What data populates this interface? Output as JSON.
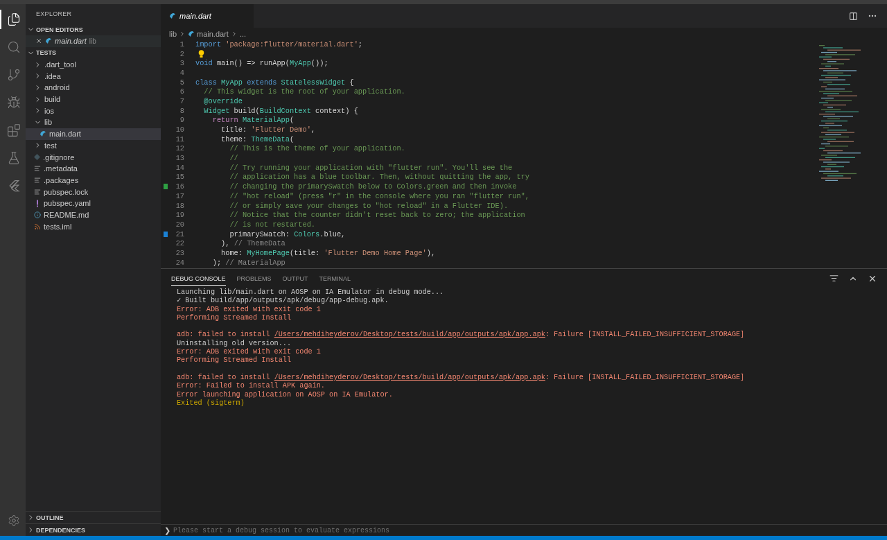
{
  "activity_bar": [
    {
      "kind": "files",
      "selected": true
    },
    {
      "kind": "search",
      "selected": false
    },
    {
      "kind": "git",
      "selected": false
    },
    {
      "kind": "debug",
      "selected": false
    },
    {
      "kind": "extensions",
      "selected": false
    },
    {
      "kind": "testing",
      "selected": false
    },
    {
      "kind": "flutter",
      "selected": false
    }
  ],
  "sidebar": {
    "title": "EXPLORER",
    "open_editors": {
      "label": "OPEN EDITORS",
      "expanded": true,
      "items": [
        {
          "name": "main.dart",
          "folder": "lib",
          "selected": false
        }
      ]
    },
    "workspace": {
      "label": "TESTS",
      "expanded": true,
      "items": [
        {
          "name": ".dart_tool",
          "kind": "folder",
          "expanded": false,
          "selected": false
        },
        {
          "name": ".idea",
          "kind": "folder",
          "expanded": false,
          "selected": false
        },
        {
          "name": "android",
          "kind": "folder",
          "expanded": false,
          "selected": false
        },
        {
          "name": "build",
          "kind": "folder",
          "expanded": false,
          "selected": false
        },
        {
          "name": "ios",
          "kind": "folder",
          "expanded": false,
          "selected": false
        },
        {
          "name": "lib",
          "kind": "folder",
          "expanded": true,
          "selected": false,
          "children": [
            {
              "name": "main.dart",
              "kind": "dart",
              "selected": true
            }
          ]
        },
        {
          "name": "test",
          "kind": "folder",
          "expanded": false,
          "selected": false
        },
        {
          "name": ".gitignore",
          "kind": "git",
          "selected": false
        },
        {
          "name": ".metadata",
          "kind": "text",
          "selected": false
        },
        {
          "name": ".packages",
          "kind": "text",
          "selected": false
        },
        {
          "name": "pubspec.lock",
          "kind": "text",
          "selected": false
        },
        {
          "name": "pubspec.yaml",
          "kind": "yaml",
          "selected": false
        },
        {
          "name": "README.md",
          "kind": "info",
          "selected": false
        },
        {
          "name": "tests.iml",
          "kind": "feed",
          "selected": false
        }
      ]
    },
    "bottom_sections": [
      {
        "label": "OUTLINE",
        "expanded": false
      },
      {
        "label": "DEPENDENCIES",
        "expanded": false
      }
    ]
  },
  "editor": {
    "tabs": [
      {
        "label": "main.dart",
        "selected": true,
        "preview": true
      }
    ],
    "breadcrumb": [
      {
        "label": "lib",
        "kind": "folder"
      },
      {
        "label": "main.dart",
        "kind": "dart"
      },
      {
        "label": "...",
        "kind": "more"
      }
    ],
    "lines": [
      {
        "number": "1",
        "tokens": [
          {
            "kind": "keyword",
            "text": "import"
          },
          {
            "kind": "string",
            "text": " 'package:flutter/material.dart'"
          },
          {
            "kind": "plain",
            "text": ";"
          }
        ]
      },
      {
        "number": "2",
        "lightbulb": true
      },
      {
        "number": "3",
        "tokens": [
          {
            "kind": "keyword",
            "text": "void"
          },
          {
            "kind": "plain",
            "text": " main() => runApp("
          },
          {
            "kind": "type",
            "text": "MyApp"
          },
          {
            "kind": "plain",
            "text": "());"
          }
        ]
      },
      {
        "number": "4"
      },
      {
        "number": "5",
        "tokens": [
          {
            "kind": "keyword",
            "text": "class"
          },
          {
            "kind": "type",
            "text": " MyApp"
          },
          {
            "kind": "keyword",
            "text": " extends"
          },
          {
            "kind": "type",
            "text": " StatelessWidget"
          },
          {
            "kind": "plain",
            "text": " {"
          }
        ]
      },
      {
        "number": "6",
        "tokens": [
          {
            "kind": "comment",
            "text": "  // This widget is the root of your application."
          }
        ]
      },
      {
        "number": "7",
        "tokens": [
          {
            "kind": "annotation",
            "text": "  @override"
          }
        ]
      },
      {
        "number": "8",
        "tokens": [
          {
            "kind": "type",
            "text": "  Widget"
          },
          {
            "kind": "plain",
            "text": " build("
          },
          {
            "kind": "type",
            "text": "BuildContext"
          },
          {
            "kind": "plain",
            "text": " context) {"
          }
        ]
      },
      {
        "number": "9",
        "tokens": [
          {
            "kind": "control",
            "text": "    return"
          },
          {
            "kind": "type",
            "text": " MaterialApp"
          },
          {
            "kind": "plain",
            "text": "("
          }
        ]
      },
      {
        "number": "10",
        "tokens": [
          {
            "kind": "plain",
            "text": "      title: "
          },
          {
            "kind": "string",
            "text": "'Flutter Demo'"
          },
          {
            "kind": "plain",
            "text": ","
          }
        ]
      },
      {
        "number": "11",
        "tokens": [
          {
            "kind": "plain",
            "text": "      theme: "
          },
          {
            "kind": "type",
            "text": "ThemeData"
          },
          {
            "kind": "plain",
            "text": "("
          }
        ]
      },
      {
        "number": "12",
        "tokens": [
          {
            "kind": "comment",
            "text": "        // This is the theme of your application."
          }
        ]
      },
      {
        "number": "13",
        "tokens": [
          {
            "kind": "comment",
            "text": "        //"
          }
        ]
      },
      {
        "number": "14",
        "tokens": [
          {
            "kind": "comment",
            "text": "        // Try running your application with \"flutter run\". You'll see the"
          }
        ]
      },
      {
        "number": "15",
        "tokens": [
          {
            "kind": "comment",
            "text": "        // application has a blue toolbar. Then, without quitting the app, try"
          }
        ]
      },
      {
        "number": "16",
        "gutter_marker": {
          "color": "#2ea043"
        },
        "tokens": [
          {
            "kind": "comment",
            "text": "        // changing the primarySwatch below to Colors.green and then invoke"
          }
        ]
      },
      {
        "number": "17",
        "tokens": [
          {
            "kind": "comment",
            "text": "        // \"hot reload\" (press \"r\" in the console where you ran \"flutter run\","
          }
        ]
      },
      {
        "number": "18",
        "tokens": [
          {
            "kind": "comment",
            "text": "        // or simply save your changes to \"hot reload\" in a Flutter IDE)."
          }
        ]
      },
      {
        "number": "19",
        "tokens": [
          {
            "kind": "comment",
            "text": "        // Notice that the counter didn't reset back to zero; the application"
          }
        ]
      },
      {
        "number": "20",
        "tokens": [
          {
            "kind": "comment",
            "text": "        // is not restarted."
          }
        ]
      },
      {
        "number": "21",
        "gutter_marker": {
          "color": "#1b81d4"
        },
        "tokens": [
          {
            "kind": "plain",
            "text": "        primarySwatch: "
          },
          {
            "kind": "type",
            "text": "Colors"
          },
          {
            "kind": "plain",
            "text": ".blue,"
          }
        ]
      },
      {
        "number": "22",
        "tokens": [
          {
            "kind": "plain",
            "text": "      ), "
          },
          {
            "kind": "hint",
            "text": "// ThemeData"
          }
        ]
      },
      {
        "number": "23",
        "tokens": [
          {
            "kind": "plain",
            "text": "      home: "
          },
          {
            "kind": "type",
            "text": "MyHomePage"
          },
          {
            "kind": "plain",
            "text": "(title: "
          },
          {
            "kind": "string",
            "text": "'Flutter Demo Home Page'"
          },
          {
            "kind": "plain",
            "text": "),"
          }
        ]
      },
      {
        "number": "24",
        "tokens": [
          {
            "kind": "plain",
            "text": "    ); "
          },
          {
            "kind": "hint",
            "text": "// MaterialApp"
          }
        ]
      }
    ]
  },
  "panel": {
    "tabs": [
      {
        "label": "DEBUG CONSOLE",
        "selected": true
      },
      {
        "label": "PROBLEMS",
        "selected": false
      },
      {
        "label": "OUTPUT",
        "selected": false
      },
      {
        "label": "TERMINAL",
        "selected": false
      }
    ],
    "output": [
      {
        "kind": "info",
        "parts": [
          {
            "s": "Launching lib/main.dart on AOSP on IA Emulator in debug mode..."
          }
        ]
      },
      {
        "kind": "info",
        "parts": [
          {
            "s": "✓ Built build/app/outputs/apk/debug/app-debug.apk."
          }
        ]
      },
      {
        "kind": "error",
        "parts": [
          {
            "s": "Error: ADB exited with exit code 1"
          }
        ]
      },
      {
        "kind": "error",
        "parts": [
          {
            "s": "Performing Streamed Install"
          }
        ]
      },
      {
        "kind": "blank"
      },
      {
        "kind": "error",
        "parts": [
          {
            "s": "adb: failed to install "
          },
          {
            "s": "/Users/mehdiheyderov/Desktop/tests/build/app/outputs/apk/app.apk",
            "link": true
          },
          {
            "s": ": Failure [INSTALL_FAILED_INSUFFICIENT_STORAGE]"
          }
        ]
      },
      {
        "kind": "info",
        "parts": [
          {
            "s": "Uninstalling old version..."
          }
        ]
      },
      {
        "kind": "error",
        "parts": [
          {
            "s": "Error: ADB exited with exit code 1"
          }
        ]
      },
      {
        "kind": "error",
        "parts": [
          {
            "s": "Performing Streamed Install"
          }
        ]
      },
      {
        "kind": "blank"
      },
      {
        "kind": "error",
        "parts": [
          {
            "s": "adb: failed to install "
          },
          {
            "s": "/Users/mehdiheyderov/Desktop/tests/build/app/outputs/apk/app.apk",
            "link": true
          },
          {
            "s": ": Failure [INSTALL_FAILED_INSUFFICIENT_STORAGE]"
          }
        ]
      },
      {
        "kind": "error",
        "parts": [
          {
            "s": "Error: Failed to install APK again."
          }
        ]
      },
      {
        "kind": "error",
        "parts": [
          {
            "s": "Error launching application on AOSP on IA Emulator."
          }
        ]
      },
      {
        "kind": "warn",
        "parts": [
          {
            "s": "Exited (sigterm)"
          }
        ]
      }
    ],
    "input": {
      "prompt": "❯",
      "placeholder": "Please start a debug session to evaluate expressions"
    }
  }
}
